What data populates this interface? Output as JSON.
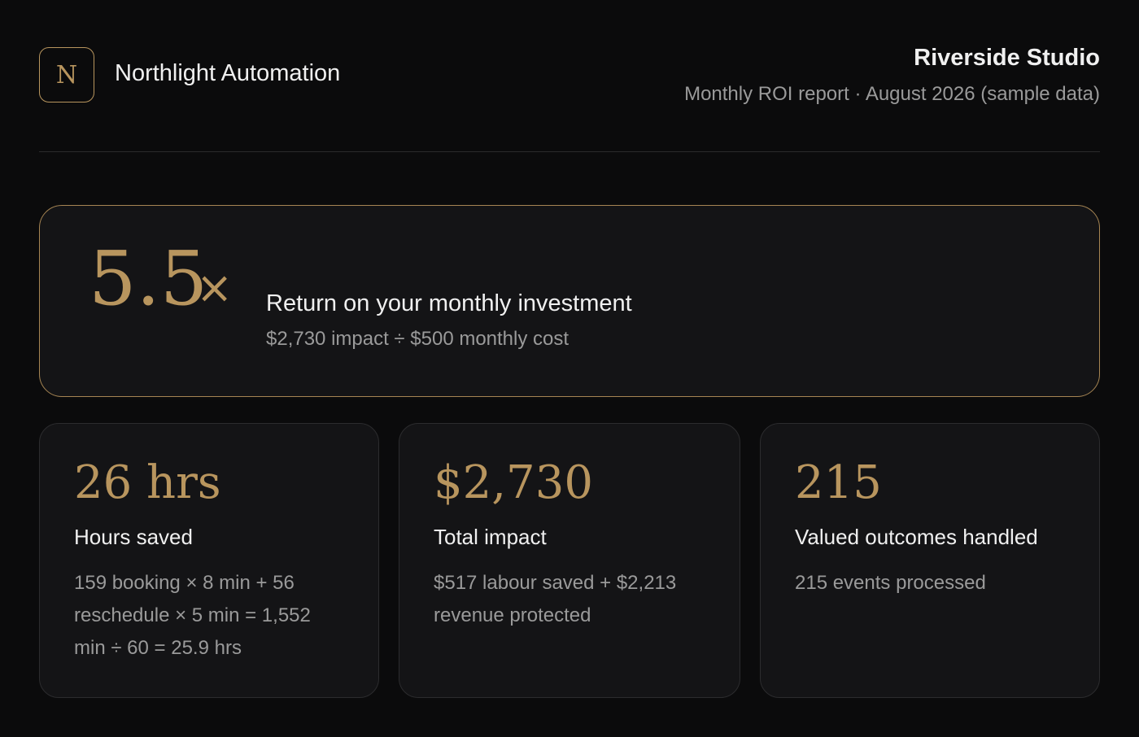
{
  "brand": {
    "mark": "N",
    "name": "Northlight Automation"
  },
  "report": {
    "client": "Riverside Studio",
    "subtitle": "Monthly ROI report · August 2026 (sample data)"
  },
  "roi": {
    "multiplier": "5.5",
    "multiplier_suffix": "×",
    "title": "Return on your monthly investment",
    "formula": "$2,730 impact ÷ $500 monthly cost"
  },
  "metrics": [
    {
      "value": "26 hrs",
      "label": "Hours saved",
      "detail": "159 booking × 8 min + 56 reschedule × 5 min = 1,552 min ÷ 60 = 25.9 hrs"
    },
    {
      "value": "$2,730",
      "label": "Total impact",
      "detail": "$517 labour saved + $2,213 revenue protected"
    },
    {
      "value": "215",
      "label": "Valued outcomes handled",
      "detail": "215 events processed"
    }
  ],
  "colors": {
    "background": "#0b0b0c",
    "card": "#141416",
    "accent_gold": "#b8955e",
    "muted_text": "#9a9a9a"
  }
}
